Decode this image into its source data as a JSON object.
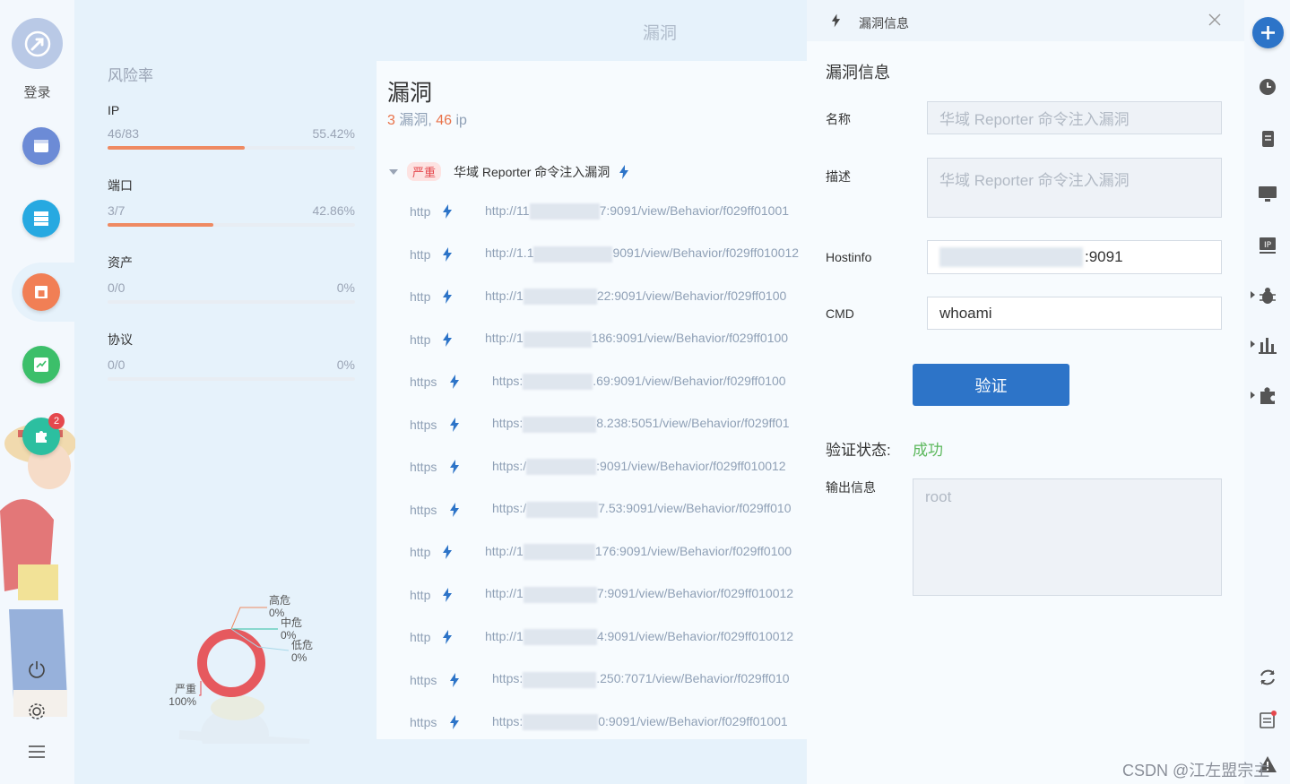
{
  "nav": {
    "login_label": "登录",
    "notification_count": "2"
  },
  "stats": {
    "title": "风险率",
    "items": [
      {
        "label": "IP",
        "count": "46/83",
        "percent": "55.42%",
        "fill": 0.5542
      },
      {
        "label": "端口",
        "count": "3/7",
        "percent": "42.86%",
        "fill": 0.4286
      },
      {
        "label": "资产",
        "count": "0/0",
        "percent": "0%",
        "fill": 0
      },
      {
        "label": "协议",
        "count": "0/0",
        "percent": "0%",
        "fill": 0
      }
    ]
  },
  "chart_data": {
    "type": "pie",
    "categories": [
      "高危",
      "中危",
      "低危",
      "严重"
    ],
    "values": [
      0,
      0,
      0,
      100
    ],
    "labels": [
      "0%",
      "0%",
      "0%",
      "100%"
    ]
  },
  "page": {
    "title": "漏洞"
  },
  "list": {
    "title": "漏洞",
    "vuln_count": "3",
    "vuln_word": " 漏洞, ",
    "ip_count": "46",
    "ip_word": " ip",
    "group": {
      "severity": "严重",
      "name": "华域 Reporter 命令注入漏洞"
    },
    "rows": [
      {
        "proto": "http",
        "prefix": "http://11",
        "suffix": "7:9091/view/Behavior/f029ff01001"
      },
      {
        "proto": "http",
        "prefix": "http://1.1",
        "suffix": "9091/view/Behavior/f029ff010012"
      },
      {
        "proto": "http",
        "prefix": "http://1",
        "suffix": "22:9091/view/Behavior/f029ff0100"
      },
      {
        "proto": "http",
        "prefix": "http://1",
        "suffix": "186:9091/view/Behavior/f029ff0100"
      },
      {
        "proto": "https",
        "prefix": "https:",
        "suffix": ".69:9091/view/Behavior/f029ff0100"
      },
      {
        "proto": "https",
        "prefix": "https:",
        "suffix": "8.238:5051/view/Behavior/f029ff01"
      },
      {
        "proto": "https",
        "prefix": "https:/",
        "suffix": ":9091/view/Behavior/f029ff010012"
      },
      {
        "proto": "https",
        "prefix": "https:/",
        "suffix": "7.53:9091/view/Behavior/f029ff010"
      },
      {
        "proto": "http",
        "prefix": "http://1",
        "suffix": "176:9091/view/Behavior/f029ff0100"
      },
      {
        "proto": "http",
        "prefix": "http://1",
        "suffix": "7:9091/view/Behavior/f029ff010012"
      },
      {
        "proto": "http",
        "prefix": "http://1",
        "suffix": "4:9091/view/Behavior/f029ff010012"
      },
      {
        "proto": "https",
        "prefix": "https:",
        "suffix": ".250:7071/view/Behavior/f029ff010"
      },
      {
        "proto": "https",
        "prefix": "https:",
        "suffix": "0:9091/view/Behavior/f029ff01001"
      }
    ]
  },
  "drawer": {
    "header_title": "漏洞信息",
    "section_title": "漏洞信息",
    "name_label": "名称",
    "name_value": "华域 Reporter 命令注入漏洞",
    "desc_label": "描述",
    "desc_value": "华域 Reporter 命令注入漏洞",
    "hostinfo_label": "Hostinfo",
    "hostinfo_value": ":9091",
    "cmd_label": "CMD",
    "cmd_value": "whoami",
    "verify_label": "验证",
    "status_label": "验证状态:",
    "status_value": "成功",
    "output_label": "输出信息",
    "output_value": "root"
  },
  "watermark": "CSDN @江左盟宗主",
  "colors": {
    "accent": "#2d74c8",
    "severity": "#e5484d",
    "bar_fill": "#ef8a62",
    "success": "#5cb85c"
  }
}
